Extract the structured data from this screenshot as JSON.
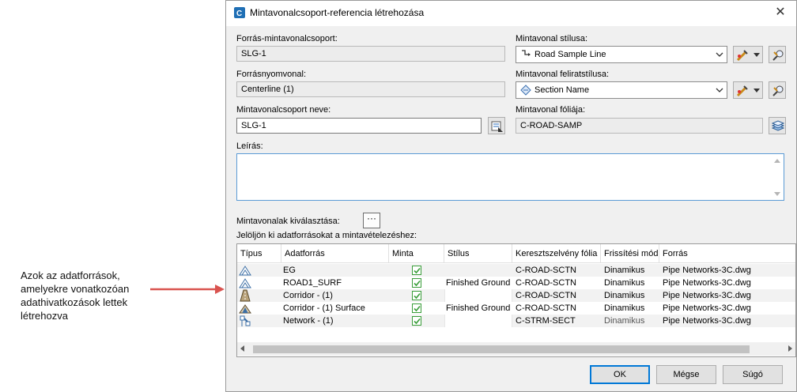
{
  "annotation": {
    "text": "Azok az adatforrások, amelyekre vonatkozóan adathivatkozások lettek létrehozva"
  },
  "dialog": {
    "title": "Mintavonalcsoport-referencia létrehozása",
    "close_symbol": "✕",
    "source_group": {
      "label": "Forrás-mintavonalcsoport:",
      "value": "SLG-1"
    },
    "source_alignment": {
      "label": "Forrásnyomvonal:",
      "value": "Centerline (1)"
    },
    "group_name": {
      "label": "Mintavonalcsoport neve:",
      "value": "SLG-1"
    },
    "sample_line_style": {
      "label": "Mintavonal stílusa:",
      "value": "Road Sample Line"
    },
    "sample_line_label_style": {
      "label": "Mintavonal feliratstílusa:",
      "value": "Section Name"
    },
    "sample_line_layer": {
      "label": "Mintavonal fóliája:",
      "value": "C-ROAD-SAMP"
    },
    "description": {
      "label": "Leírás:",
      "value": ""
    },
    "select_sample_lines": {
      "label": "Mintavonalak kiválasztása:",
      "button": "···"
    },
    "sources_hint": "Jelöljön ki adatforrásokat a mintavételezéshez:",
    "table": {
      "headers": [
        "Típus",
        "Adatforrás",
        "Minta",
        "Stílus",
        "Keresztszelvény fólia",
        "Frissítési mód",
        "Forrás"
      ],
      "rows": [
        {
          "type_icon": "surface-icon",
          "source": "EG",
          "sample": true,
          "style": "",
          "layer": "C-ROAD-SCTN",
          "update": "Dinamikus",
          "origin": "Pipe Networks-3C.dwg"
        },
        {
          "type_icon": "surface-icon",
          "source": "ROAD1_SURF",
          "sample": true,
          "style": "Finished Ground",
          "layer": "C-ROAD-SCTN",
          "update": "Dinamikus",
          "origin": "Pipe Networks-3C.dwg"
        },
        {
          "type_icon": "corridor-icon",
          "source": "Corridor - (1)",
          "sample": true,
          "style": "",
          "layer": "C-ROAD-SCTN",
          "update": "Dinamikus",
          "origin": "Pipe Networks-3C.dwg"
        },
        {
          "type_icon": "corridor-surface-icon",
          "source": "Corridor - (1) Surface",
          "sample": true,
          "style": "Finished Ground",
          "layer": "C-ROAD-SCTN",
          "update": "Dinamikus",
          "origin": "Pipe Networks-3C.dwg"
        },
        {
          "type_icon": "pipe-network-icon",
          "source": "Network - (1)",
          "sample": true,
          "style": "",
          "layer": "C-STRM-SECT",
          "update": "Dinamikus",
          "origin": "Pipe Networks-3C.dwg"
        }
      ]
    },
    "buttons": {
      "ok": "OK",
      "cancel": "Mégse",
      "help": "Súgó"
    }
  },
  "colors": {
    "accent": "#0078d7",
    "check": "#3a9d3a",
    "arrow": "#d9534f"
  }
}
